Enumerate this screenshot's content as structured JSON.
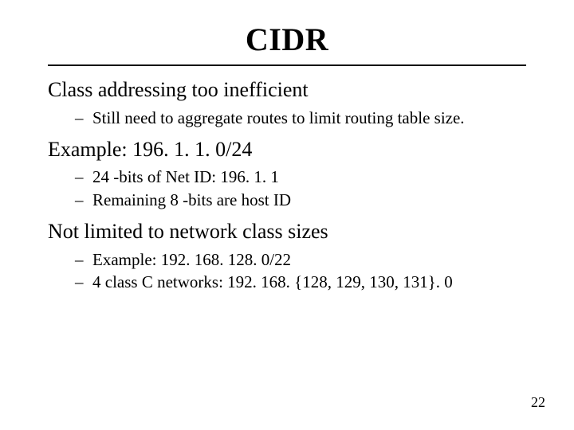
{
  "title": "CIDR",
  "sections": [
    {
      "heading": "Class addressing too inefficient",
      "items": [
        "Still need to aggregate routes to limit routing table size."
      ]
    },
    {
      "heading": "Example: 196. 1. 1. 0/24",
      "items": [
        "24 -bits of Net ID: 196. 1. 1",
        "Remaining 8 -bits are host ID"
      ]
    },
    {
      "heading": "Not limited to network class sizes",
      "items": [
        "Example: 192. 168. 128. 0/22",
        "4 class C networks: 192. 168. {128, 129, 130, 131}. 0"
      ]
    }
  ],
  "page_number": "22",
  "dash": "–"
}
